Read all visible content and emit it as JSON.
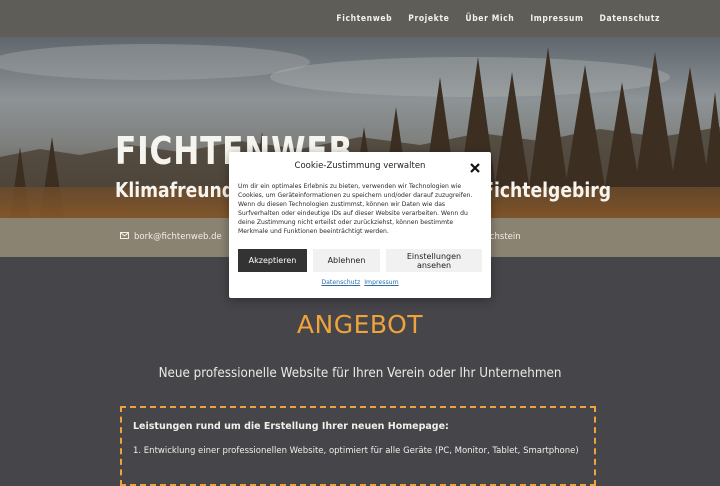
{
  "nav": {
    "items": [
      "Fichtenweb",
      "Projekte",
      "Über Mich",
      "Impressum",
      "Datenschutz"
    ]
  },
  "hero": {
    "title": "FICHTENWEB",
    "subtitle": "Klimafreundliche Webseiten aus dem Fichtelgebirg"
  },
  "contact": {
    "email": "bork@fichtenweb.de",
    "location_partial": "richstein",
    "mail_icon": "mail-icon"
  },
  "section": {
    "title": "ANGEBOT",
    "subtitle": "Neue professionelle Website für Ihren Verein oder Ihr Unternehmen",
    "box_title": "Leistungen rund um die Erstellung Ihrer neuen Homepage:",
    "box_item": "1. Entwicklung einer professionellen Website, optimiert für alle Geräte (PC, Monitor, Tablet, Smartphone)"
  },
  "cookie": {
    "title": "Cookie-Zustimmung verwalten",
    "text": "Um dir ein optimales Erlebnis zu bieten, verwenden wir Technologien wie Cookies, um Geräteinformationen zu speichern und/oder darauf zuzugreifen. Wenn du diesen Technologien zustimmst, können wir Daten wie das Surfverhalten oder eindeutige IDs auf dieser Website verarbeiten. Wenn du deine Zustimmung nicht erteilst oder zurückziehst, können bestimmte Merkmale und Funktionen beeinträchtigt werden.",
    "accept": "Akzeptieren",
    "deny": "Ablehnen",
    "prefs": "Einstellungen ansehen",
    "link_privacy": "Datenschutz",
    "link_imprint": "Impressum",
    "close_icon": "close-icon"
  },
  "colors": {
    "accent": "#f0a33a",
    "nav_bg": "#5f5d57",
    "strip_bg": "#8a8372",
    "page_bg": "#45454a",
    "button_dark": "#333333",
    "link": "#2b6ea8"
  }
}
